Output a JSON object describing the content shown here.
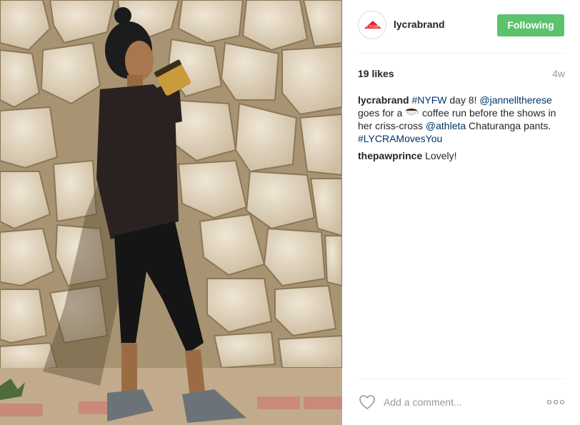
{
  "post": {
    "image_alt": "Woman in black sweatshirt and criss-cross leggings drinking coffee in front of a stone wall",
    "colors": {
      "follow_button": "#5bc26e",
      "link": "#003569",
      "muted": "#999999",
      "brand_red": "#e0242f"
    }
  },
  "header": {
    "avatar_icon": "lycra-logo-icon",
    "avatar_text": "LYCRA",
    "username": "lycrabrand",
    "follow_label": "Following"
  },
  "meta": {
    "likes": "19 likes",
    "time_ago": "4w"
  },
  "caption": {
    "author": "lycrabrand",
    "parts": {
      "tag_nyfw": "#NYFW",
      "text_1": " day 8! ",
      "mention_1": "@jannelltherese",
      "text_2": " goes for a ",
      "emoji": "coffee-icon",
      "text_3": " coffee run before the shows in her criss-cross ",
      "mention_2": "@athleta",
      "text_4": " Chaturanga pants. ",
      "tag_lycra": "#LYCRAMovesYou"
    }
  },
  "comments": [
    {
      "author": "thepawprince",
      "text": " Lovely!"
    }
  ],
  "comment_bar": {
    "like_icon": "heart-icon",
    "placeholder": "Add a comment...",
    "more_icon": "more-options-icon"
  }
}
